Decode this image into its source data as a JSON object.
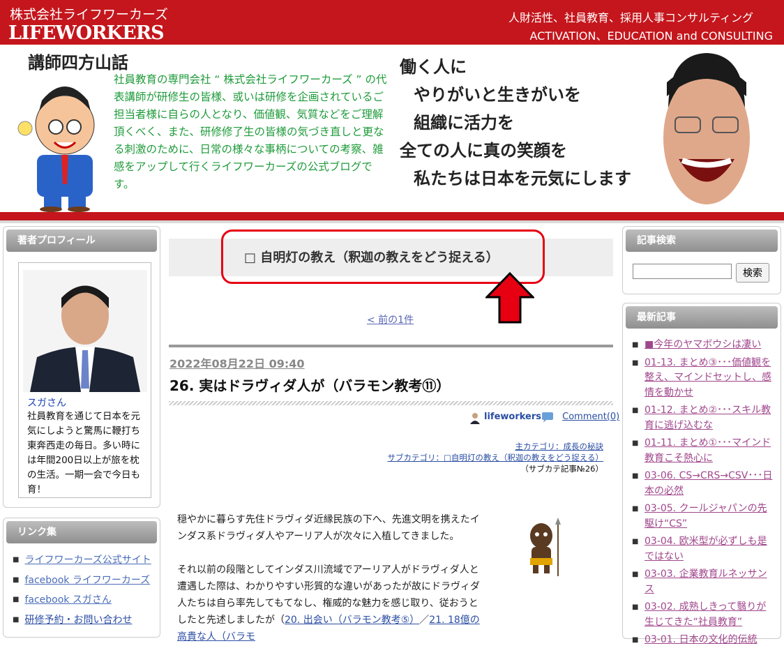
{
  "header": {
    "company_jp": "株式会社ライフワーカーズ",
    "company_en": "LIFEWORKERS",
    "tagline_jp": "人財活性、社員教育、採用人事コンサルティング",
    "tagline_en": "ACTIVATION、EDUCATION and CONSULTING"
  },
  "banner": {
    "title": "講師四方山話",
    "description": "社員教育の専門会社 “ 株式会社ライフワーカーズ ” の代表講師が研修生の皆様、或いは研修を企画されているご担当者様に自らの人となり、価値観、気質などをご理解頂くべく、また、研修修了生の皆様の気づき直しと更なる刺激のために、日常の様々な事柄についての考察、雑感をアップして行くライフワーカーズの公式ブログです。",
    "slogan": [
      "働く人に",
      "やりがいと生きがいを",
      "組織に活力を",
      "全ての人に真の笑顔を",
      "私たちは日本を元気にします"
    ]
  },
  "left_sidebar": {
    "profile_heading": "著者プロフィール",
    "profile_name": "スガさん",
    "profile_text": "社員教育を通じて日本を元気にしようと驚馬に鞭打ち東奔西走の毎日。多い時には年間200日以上が旅を枕の生活。一期一会で今日も育！",
    "links_heading": "リンク集",
    "links": [
      "ライフワーカーズ公式サイト",
      "facebook ライフワーカーズ",
      "facebook スガさん",
      "研修予約・お問い合わせ"
    ]
  },
  "main": {
    "category_title": "□ 自明灯の教え（釈迦の教えをどう捉える）",
    "prev_link": "< 前の1件",
    "post_date": "2022年08月22日 09:40",
    "post_title": "26. 実はドラヴィダ人が（バラモン教考⑪）",
    "author": "lifeworkers",
    "comment": "Comment(0)",
    "main_category": "主カテゴリ：成長の秘訣",
    "sub_category": "サブカテゴリ：□自明灯の教え（釈迦の教えをどう捉える）",
    "sub_count": "（サブカテ記事№26）",
    "paragraph1": "穏やかに暮らす先住ドラヴィダ近縁民族の下へ、先進文明を携えたインダス系ドラヴィダ人やアーリア人が次々に入植してきました。",
    "paragraph2_text": "それ以前の段階としてインダス川流域でアーリア人がドラヴィダ人と遭遇した際は、わかりやすい形質的な違いがあったが故にドラヴィダ人たちは自ら率先してもてなし、権威的な魅力を感じ取り、従おうとしたと先述しましたが（",
    "paragraph2_link1": "20. 出会い（バラモン教考⑤）",
    "paragraph2_sep": "／",
    "paragraph2_link2": "21. 18億の高貴な人（バラモ"
  },
  "right_sidebar": {
    "search_heading": "記事検索",
    "search_button": "検索",
    "recent_heading": "最新記事",
    "recent_posts": [
      "■今年のヤマボウシは凄い",
      "01-13. まとめ③･･･価値観を整え、マインドセットし、感情を動かせ",
      "01-12. まとめ②･･･スキル教育に逃げ込むな",
      "01-11. まとめ①･･･マインド教育こそ熱心に",
      "03-06. CS→CRS→CSV･･･日本の必然",
      "03-05. クールジャパンの先駆け“CS”",
      "03-04. 欧米型が必ずしも是ではない",
      "03-03. 企業教育ルネッサンス",
      "03-02. 成熟しきって翳りが生じてきた“社員教育”",
      "03-01. 日本の文化的伝統"
    ]
  },
  "colors": {
    "brand_red": "#c4161c",
    "banner_green": "#1e9b3a",
    "annotation_red": "#e60012"
  }
}
